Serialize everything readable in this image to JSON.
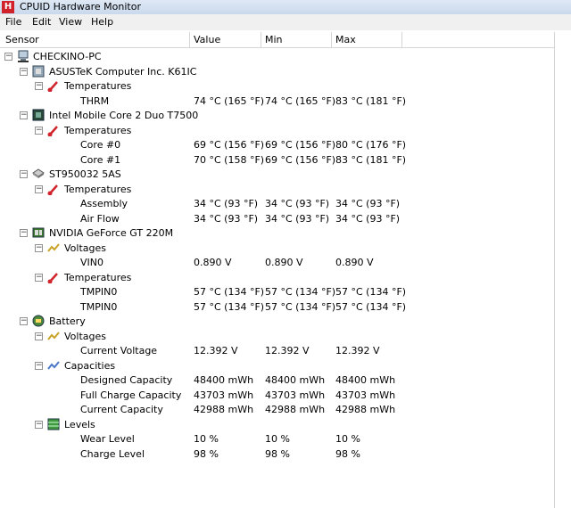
{
  "window": {
    "title": "CPUID Hardware Monitor"
  },
  "menu": [
    "File",
    "Edit",
    "View",
    "Help"
  ],
  "columns": [
    "Sensor",
    "Value",
    "Min",
    "Max"
  ],
  "tree": {
    "root": "CHECKINO-PC",
    "devices": [
      {
        "name": "ASUSTeK Computer Inc. K61IC",
        "groups": [
          {
            "name": "Temperatures",
            "sensors": [
              {
                "name": "THRM",
                "value": "74 °C  (165 °F)",
                "min": "74 °C  (165 °F)",
                "max": "83 °C  (181 °F)"
              }
            ]
          }
        ]
      },
      {
        "name": "Intel Mobile Core 2 Duo T7500",
        "groups": [
          {
            "name": "Temperatures",
            "sensors": [
              {
                "name": "Core #0",
                "value": "69 °C  (156 °F)",
                "min": "69 °C  (156 °F)",
                "max": "80 °C  (176 °F)"
              },
              {
                "name": "Core #1",
                "value": "70 °C  (158 °F)",
                "min": "69 °C  (156 °F)",
                "max": "83 °C  (181 °F)"
              }
            ]
          }
        ]
      },
      {
        "name": "ST950032 5AS",
        "groups": [
          {
            "name": "Temperatures",
            "sensors": [
              {
                "name": "Assembly",
                "value": "34 °C  (93 °F)",
                "min": "34 °C  (93 °F)",
                "max": "34 °C  (93 °F)"
              },
              {
                "name": "Air Flow",
                "value": "34 °C  (93 °F)",
                "min": "34 °C  (93 °F)",
                "max": "34 °C  (93 °F)"
              }
            ]
          }
        ]
      },
      {
        "name": "NVIDIA GeForce GT 220M",
        "groups": [
          {
            "name": "Voltages",
            "sensors": [
              {
                "name": "VIN0",
                "value": "0.890 V",
                "min": "0.890 V",
                "max": "0.890 V"
              }
            ]
          },
          {
            "name": "Temperatures",
            "sensors": [
              {
                "name": "TMPIN0",
                "value": "57 °C  (134 °F)",
                "min": "57 °C  (134 °F)",
                "max": "57 °C  (134 °F)"
              },
              {
                "name": "TMPIN0",
                "value": "57 °C  (134 °F)",
                "min": "57 °C  (134 °F)",
                "max": "57 °C  (134 °F)"
              }
            ]
          }
        ]
      },
      {
        "name": "Battery",
        "groups": [
          {
            "name": "Voltages",
            "sensors": [
              {
                "name": "Current Voltage",
                "value": "12.392 V",
                "min": "12.392 V",
                "max": "12.392 V"
              }
            ]
          },
          {
            "name": "Capacities",
            "sensors": [
              {
                "name": "Designed Capacity",
                "value": "48400 mWh",
                "min": "48400 mWh",
                "max": "48400 mWh"
              },
              {
                "name": "Full Charge Capacity",
                "value": "43703 mWh",
                "min": "43703 mWh",
                "max": "43703 mWh"
              },
              {
                "name": "Current Capacity",
                "value": "42988 mWh",
                "min": "42988 mWh",
                "max": "42988 mWh"
              }
            ]
          },
          {
            "name": "Levels",
            "sensors": [
              {
                "name": "Wear Level",
                "value": "10 %",
                "min": "10 %",
                "max": "10 %"
              },
              {
                "name": "Charge Level",
                "value": "98 %",
                "min": "98 %",
                "max": "98 %"
              }
            ]
          }
        ]
      }
    ]
  },
  "colors": {
    "thermo": "#d0232b",
    "volt": "#c9a227",
    "capacity": "#4a78c8",
    "level": "#3f9a3f"
  }
}
